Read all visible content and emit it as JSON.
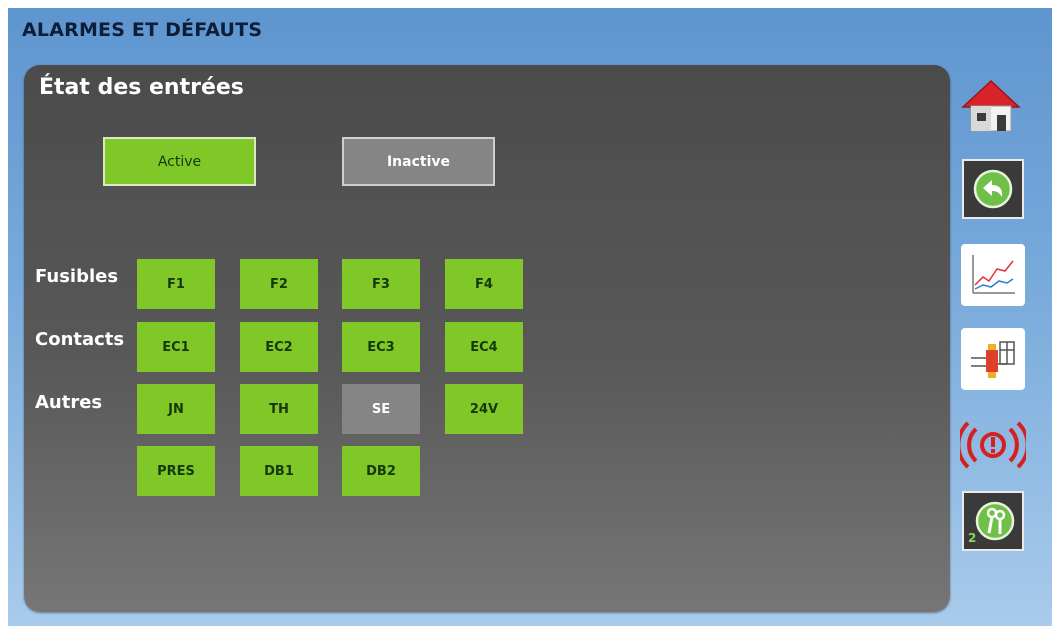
{
  "header": {
    "title": "ALARMES ET DÉFAUTS"
  },
  "panel": {
    "title": "État des entrées",
    "legend": {
      "active": "Active",
      "inactive": "Inactive"
    }
  },
  "rows": [
    {
      "label": "Fusibles",
      "cells": [
        {
          "label": "F1",
          "state": "active"
        },
        {
          "label": "F2",
          "state": "active"
        },
        {
          "label": "F3",
          "state": "active"
        },
        {
          "label": "F4",
          "state": "active"
        }
      ]
    },
    {
      "label": "Contacts",
      "cells": [
        {
          "label": "EC1",
          "state": "active"
        },
        {
          "label": "EC2",
          "state": "active"
        },
        {
          "label": "EC3",
          "state": "active"
        },
        {
          "label": "EC4",
          "state": "active"
        }
      ]
    },
    {
      "label": "Autres",
      "cells": [
        {
          "label": "JN",
          "state": "active"
        },
        {
          "label": "TH",
          "state": "active"
        },
        {
          "label": "SE",
          "state": "inactive"
        },
        {
          "label": "24V",
          "state": "active"
        }
      ]
    },
    {
      "label": "",
      "cells": [
        {
          "label": "PRES",
          "state": "active"
        },
        {
          "label": "DB1",
          "state": "active"
        },
        {
          "label": "DB2",
          "state": "active"
        }
      ]
    }
  ],
  "sidebar": {
    "items": [
      {
        "icon": "home-icon"
      },
      {
        "icon": "back-arrow-icon"
      },
      {
        "icon": "trend-chart-icon"
      },
      {
        "icon": "hydraulic-schematic-icon"
      },
      {
        "icon": "alarm-icon"
      },
      {
        "icon": "keys-icon",
        "badge": "2"
      }
    ]
  },
  "colors": {
    "active": "#80c828",
    "inactive": "#858585",
    "alarm": "#d42020"
  }
}
